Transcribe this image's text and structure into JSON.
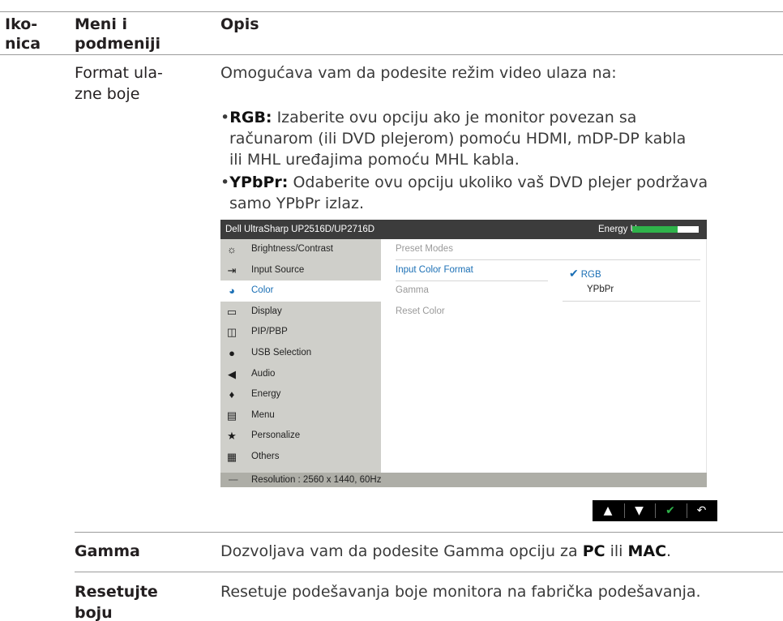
{
  "table_header": {
    "col1_line1": "Iko-",
    "col1_line2": "nica",
    "col2_line1": "Meni i",
    "col2_line2": "podmeniji",
    "col3": "Opis"
  },
  "row_format": {
    "menu_line1": "Format ula-",
    "menu_line2": "zne boje",
    "intro": "Omogućava vam da podesite režim video ulaza na:",
    "bullets": [
      {
        "mark": "•",
        "term": "RGB:",
        "line1": " Izaberite ovu opciju ako je monitor povezan sa",
        "line2": "računarom (ili DVD plejerom) pomoću HDMI, mDP-DP kabla",
        "line3": "ili MHL uređajima pomoću MHL kabla."
      },
      {
        "mark": "•",
        "term": "YPbPr:",
        "line1": " Odaberite ovu opciju ukoliko vaš DVD plejer podržava",
        "line2": "samo YPbPr izlaz."
      }
    ]
  },
  "osd": {
    "title": "Dell UltraSharp UP2516D/UP2716D",
    "energy_label": "Energy Use",
    "energy_level": 0.68,
    "energy_color": "#2fb34a",
    "accent_color": "#1a6fb5",
    "menu": [
      {
        "icon": "brightness-icon",
        "glyph": "☼",
        "label": "Brightness/Contrast"
      },
      {
        "icon": "input-source-icon",
        "glyph": "⇥",
        "label": "Input Source"
      },
      {
        "icon": "color-icon",
        "glyph": "◕",
        "label": "Color"
      },
      {
        "icon": "display-icon",
        "glyph": "▭",
        "label": "Display"
      },
      {
        "icon": "pip-pbp-icon",
        "glyph": "◫",
        "label": "PIP/PBP"
      },
      {
        "icon": "usb-icon",
        "glyph": "●",
        "label": "USB Selection"
      },
      {
        "icon": "audio-icon",
        "glyph": "◀",
        "label": "Audio"
      },
      {
        "icon": "energy-icon",
        "glyph": "♦",
        "label": "Energy"
      },
      {
        "icon": "menu-icon",
        "glyph": "▤",
        "label": "Menu"
      },
      {
        "icon": "star-icon",
        "glyph": "★",
        "label": "Personalize"
      },
      {
        "icon": "others-icon",
        "glyph": "▦",
        "label": "Others"
      }
    ],
    "active_menu": "Color",
    "submenu": [
      {
        "label": "Preset Modes"
      },
      {
        "label": "Input Color Format"
      },
      {
        "label": "Gamma"
      },
      {
        "label": "Reset Color"
      }
    ],
    "options": {
      "selected": "RGB",
      "other": "YPbPr"
    },
    "footer": "Resolution : 2560 x 1440, 60Hz",
    "buttons": [
      {
        "icon": "chevron-up-icon",
        "glyph": "▲"
      },
      {
        "icon": "chevron-down-icon",
        "glyph": "▼"
      },
      {
        "icon": "check-icon",
        "glyph": "✔"
      },
      {
        "icon": "back-icon",
        "glyph": "↶"
      }
    ]
  },
  "row_gamma": {
    "menu": "Gamma",
    "desc_prefix": "Dozvoljava vam da podesite Gamma opciju za ",
    "pc": "PC",
    "mid": " ili ",
    "mac": "MAC",
    "end": "."
  },
  "row_reset": {
    "menu_line1": "Resetujte",
    "menu_line2": "boju",
    "desc": "Resetuje podešavanja boje monitora na fabrička podešavanja."
  }
}
